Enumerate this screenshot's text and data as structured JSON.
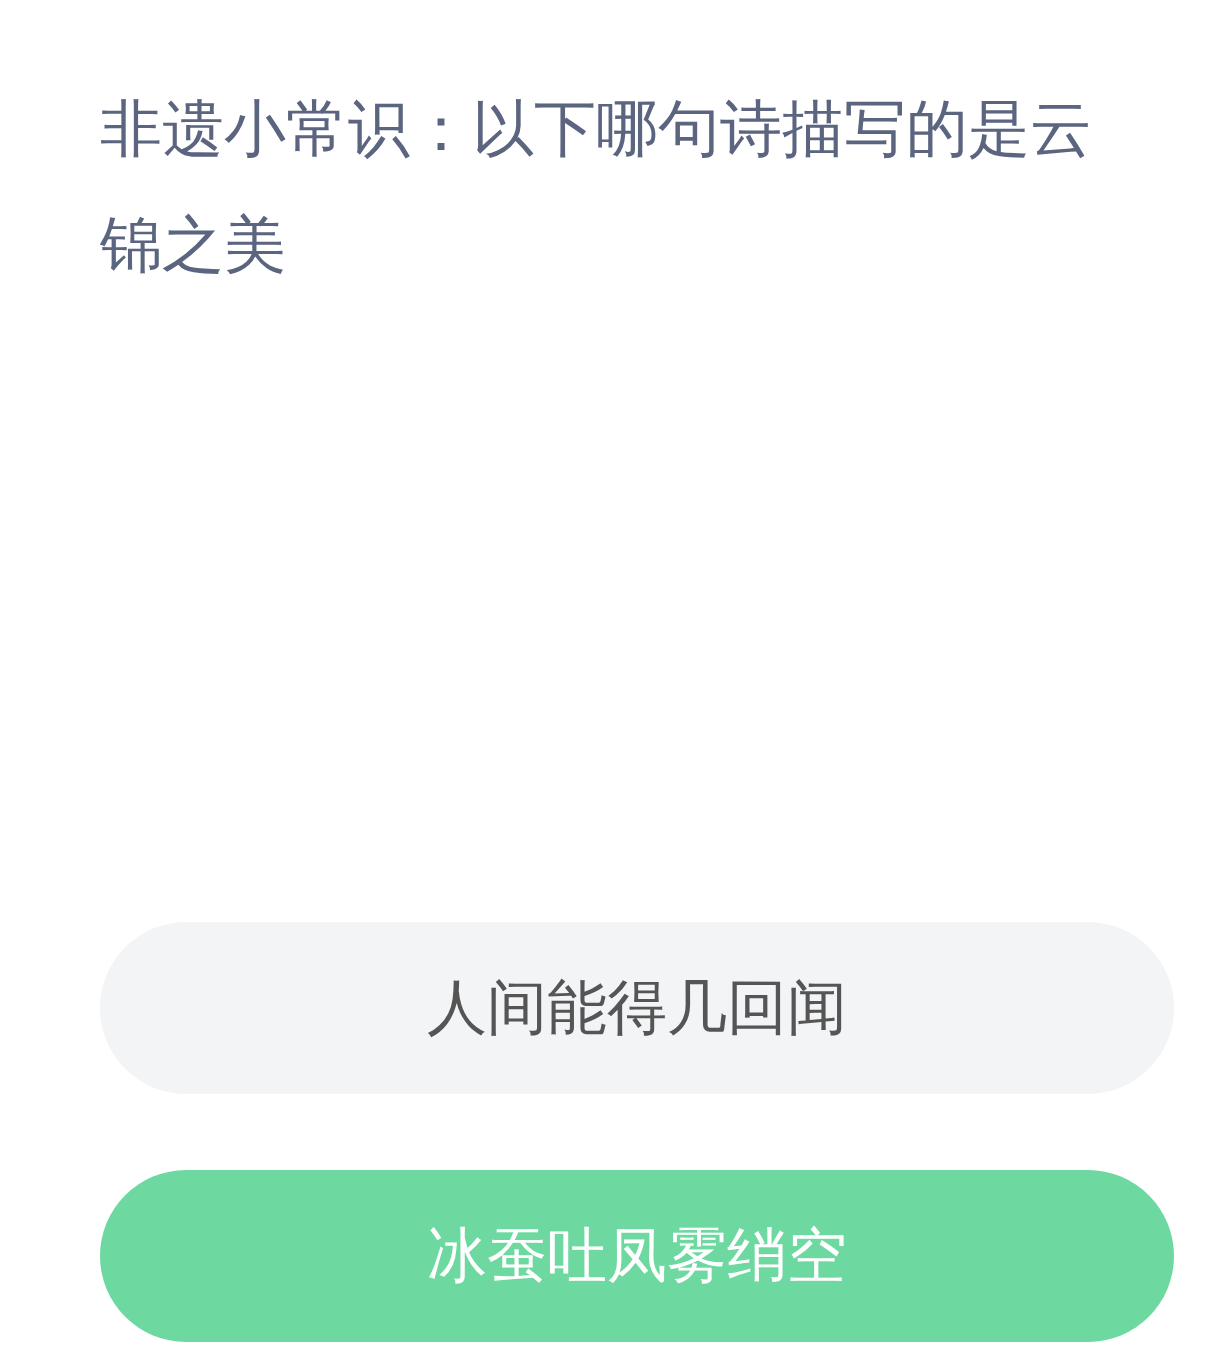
{
  "question": "非遗小常识：以下哪句诗描写的是云锦之美",
  "options": [
    {
      "label": "人间能得几回闻",
      "selected": false
    },
    {
      "label": "冰蚕吐凤雾绡空",
      "selected": true
    }
  ]
}
